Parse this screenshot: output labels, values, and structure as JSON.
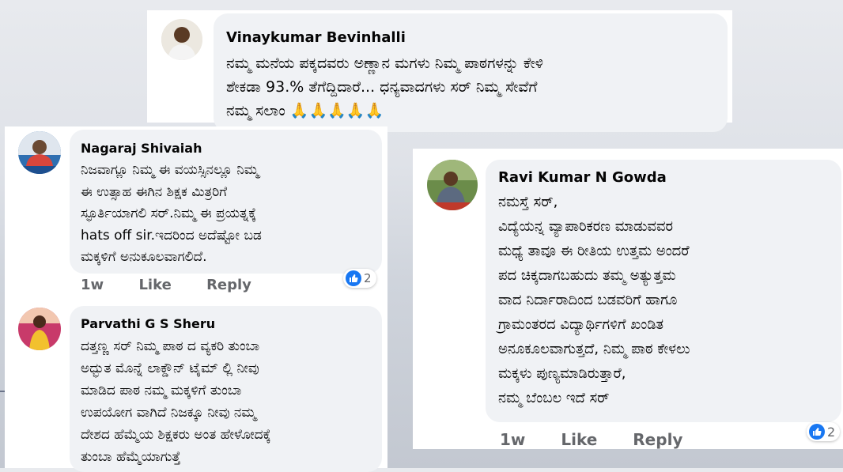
{
  "comments": [
    {
      "name": "Vinaykumar Bevinhalli",
      "lines": [
        "ನಮ್ಮ ಮನೆಯ ಪಕ್ಕದವರು ಅಣ್ಣಾನ ಮಗಳು ನಿಮ್ಮ ಪಾಠಗಳನ್ನು ಕೇಳಿ",
        "ಶೇಕಡಾ 93.% ತೆಗೆದ್ದಿದಾರೆ... ಧನ್ಯವಾದಗಳು ಸರ್ ನಿಮ್ಮ ಸೇವೆಗೆ",
        "ನಮ್ಮ ಸಲಾಂ 🙏🙏🙏🙏🙏"
      ]
    },
    {
      "name": "Nagaraj Shivaiah",
      "lines": [
        "ನಿಜವಾಗ್ಲೂ ನಿಮ್ಮ ಈ ವಯಸ್ಸಿನಲ್ಲೂ ನಿಮ್ಮ",
        "ಈ ಉತ್ಸಾಹ ಈಗಿನ ಶಿಕ್ಷಕ ಮಿತ್ರರಿಗೆ",
        "ಸ್ಫೂರ್ತಿಯಾಗಲಿ ಸರ್.ನಿಮ್ಮ ಈ ಪ್ರಯತ್ನಕ್ಕೆ",
        "hats off sir.ಇದರಿಂದ ಅದೆಷ್ಟೋ ಬಡ",
        "ಮಕ್ಕಳಿಗೆ ಅನುಕೂಲವಾಗಲಿದೆ."
      ],
      "time": "1w",
      "like": "Like",
      "reply": "Reply",
      "reactions": "2"
    },
    {
      "name": "Parvathi G S Sheru",
      "lines": [
        "ದತ್ತಣ್ಣ ಸರ್ ನಿಮ್ಮ ಪಾಠ ದ ವ್ಯಕರಿ ತುಂಬಾ",
        "ಅದ್ಭುತ ಮೊನ್ನೆ ಲಾಕ್ಡೌನ್ ಟೈಮ್ ಲ್ಲಿ ನೀವು",
        "ಮಾಡಿದ ಪಾಠ ನಮ್ಮ ಮಕ್ಕಳಿಗೆ ತುಂಬಾ",
        "ಉಪಯೋಗ ವಾಗಿದೆ ನಿಜಕ್ಕೂ ನೀವು ನಮ್ಮ",
        "ದೇಶದ ಹೆಮ್ಮೆಯ ಶಿಕ್ಷಕರು ಅಂತ ಹೇಳೋದಕ್ಕೆ",
        "ತುಂಬಾ ಹೆಮ್ಮೆಯಾಗುತ್ತೆ"
      ]
    },
    {
      "name": "Ravi Kumar N Gowda",
      "lines": [
        "ನಮಸ್ತೆ ಸರ್,",
        " ವಿದ್ಯೆಯನ್ನ ವ್ಯಾಪಾರಿಕರಣ ಮಾಡುವವರ",
        "ಮಧ್ಯೆ ತಾವೂ ಈ ರೀತಿಯ ಉತ್ತಮ ಅಂದರೆ",
        "ಪದ ಚಿಕ್ಕದಾಗಬಹುದು ತಮ್ಮ ಅತ್ಯುತ್ತಮ",
        "ವಾದ ನಿರ್ದಾರಾದಿಂದ ಬಡವರಿಗೆ ಹಾಗೂ",
        "ಗ್ರಾಮಂತರದ ವಿದ್ಯಾರ್ಥಿಗಳಿಗೆ ಖಂಡಿತ",
        "ಅನೂಕೂಲವಾಗುತ್ತದೆ, ನಿಮ್ಮ ಪಾಠ ಕೇಳಲು",
        "ಮಕ್ಕಳು ಪುಣ್ಯಮಾಡಿರುತ್ತಾರೆ,",
        "ನಮ್ಮ ಬೆಂಬಲ ಇದೆ ಸರ್"
      ],
      "time": "1w",
      "like": "Like",
      "reply": "Reply",
      "reactions": "2"
    }
  ],
  "colors": {
    "bubble": "#f0f2f5",
    "meta": "#65676b",
    "like_blue": "#1877f2"
  }
}
